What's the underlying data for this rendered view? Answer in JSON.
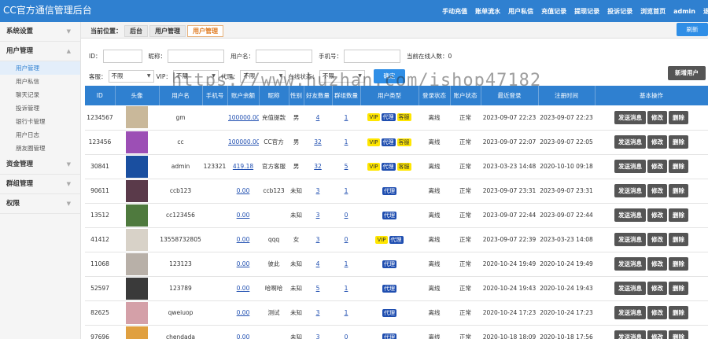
{
  "header": {
    "title": "CC官方通信管理后台",
    "nav": [
      "手动充值",
      "账单流水",
      "用户私信",
      "充值记录",
      "提现记录",
      "投诉记录",
      "浏览首页",
      "admin",
      "退出"
    ]
  },
  "sidebar": {
    "groups": [
      {
        "label": "系统设置"
      },
      {
        "label": "用户管理"
      },
      {
        "label": "资金管理"
      },
      {
        "label": "群组管理"
      },
      {
        "label": "权限"
      }
    ],
    "user_items": [
      "用户管理",
      "用户私信",
      "聊天记录",
      "投诉管理",
      "银行卡管理",
      "用户日志",
      "朋友圈管理"
    ]
  },
  "breadcrumb": {
    "label": "当前位置：",
    "segments": [
      "后台",
      "用户管理",
      "用户管理"
    ]
  },
  "refresh_label": "刷新",
  "filters": {
    "id_label": "ID：",
    "nick_label": "昵称：",
    "user_label": "用户名：",
    "phone_label": "手机号：",
    "online_text": "当前在线人数：0",
    "cs_label": "客服：",
    "vip_label": "VIP：",
    "agent_label": "代理：",
    "online_label": "在线状态：",
    "option": "不限",
    "submit": "确定",
    "add_user": "新增用户"
  },
  "watermark": "https://www.huzhan.com/ishop47182",
  "table": {
    "headers": [
      "ID",
      "头像",
      "用户名",
      "手机号",
      "账户余额",
      "昵称",
      "性别",
      "好友数量",
      "群组数量",
      "用户类型",
      "登录状态",
      "账户状态",
      "最近登录",
      "注册时间",
      "基本操作"
    ],
    "actions": [
      "发送消息",
      "修改",
      "删除"
    ],
    "rows": [
      {
        "id": "1234567",
        "user": "gm",
        "phone": "",
        "balance": "100000.00",
        "nick": "充值提款",
        "sex": "男",
        "friends": "4",
        "groups": "1",
        "tags": [
          "VIP",
          "代理",
          "客服"
        ],
        "login": "离线",
        "status": "正常",
        "last": "2023-09-07 22:23",
        "reg": "2023-09-07 22:23",
        "avatar": "#c9b89a"
      },
      {
        "id": "123456",
        "user": "cc",
        "phone": "",
        "balance": "100000.00",
        "nick": "CC官方",
        "sex": "男",
        "friends": "32",
        "groups": "1",
        "tags": [
          "VIP",
          "代理",
          "客服"
        ],
        "login": "离线",
        "status": "正常",
        "last": "2023-09-07 22:07",
        "reg": "2023-09-07 22:05",
        "avatar": "#9c4fb5"
      },
      {
        "id": "30841",
        "user": "admin",
        "phone": "123321",
        "balance": "419.18",
        "nick": "官方客服",
        "sex": "男",
        "friends": "32",
        "groups": "5",
        "tags": [
          "VIP",
          "代理",
          "客服"
        ],
        "login": "离线",
        "status": "正常",
        "last": "2023-03-23 14:48",
        "reg": "2020-10-10 09:18",
        "avatar": "#1a4fa0"
      },
      {
        "id": "90611",
        "user": "ccb123",
        "phone": "",
        "balance": "0.00",
        "nick": "ccb123",
        "sex": "未知",
        "friends": "3",
        "groups": "1",
        "tags": [
          "代理"
        ],
        "login": "离线",
        "status": "正常",
        "last": "2023-09-07 23:31",
        "reg": "2023-09-07 23:31",
        "avatar": "#5a3a4a"
      },
      {
        "id": "13512",
        "user": "cc123456",
        "phone": "",
        "balance": "0.00",
        "nick": "",
        "sex": "未知",
        "friends": "3",
        "groups": "0",
        "tags": [
          "代理"
        ],
        "login": "离线",
        "status": "正常",
        "last": "2023-09-07 22:44",
        "reg": "2023-09-07 22:44",
        "avatar": "#4f7a3e"
      },
      {
        "id": "41412",
        "user": "13558732805",
        "phone": "",
        "balance": "0.00",
        "nick": "qqq",
        "sex": "女",
        "friends": "3",
        "groups": "0",
        "tags": [
          "VIP",
          "代理"
        ],
        "login": "离线",
        "status": "正常",
        "last": "2023-09-07 22:39",
        "reg": "2023-03-23 14:08",
        "avatar": "#d8d2c8"
      },
      {
        "id": "11068",
        "user": "123123",
        "phone": "",
        "balance": "0.00",
        "nick": "彼此",
        "sex": "未知",
        "friends": "4",
        "groups": "1",
        "tags": [
          "代理"
        ],
        "login": "离线",
        "status": "正常",
        "last": "2020-10-24 19:49",
        "reg": "2020-10-24 19:49",
        "avatar": "#b8b0a8"
      },
      {
        "id": "52597",
        "user": "123789",
        "phone": "",
        "balance": "0.00",
        "nick": "哈啊哈",
        "sex": "未知",
        "friends": "5",
        "groups": "1",
        "tags": [
          "代理"
        ],
        "login": "离线",
        "status": "正常",
        "last": "2020-10-24 19:43",
        "reg": "2020-10-24 19:43",
        "avatar": "#3a3a3a"
      },
      {
        "id": "82625",
        "user": "qweiuop",
        "phone": "",
        "balance": "0.00",
        "nick": "测试",
        "sex": "未知",
        "friends": "3",
        "groups": "1",
        "tags": [
          "代理"
        ],
        "login": "离线",
        "status": "正常",
        "last": "2020-10-24 17:23",
        "reg": "2020-10-24 17:23",
        "avatar": "#d4a0a8"
      },
      {
        "id": "97696",
        "user": "chendada",
        "phone": "",
        "balance": "0.00",
        "nick": "",
        "sex": "未知",
        "friends": "3",
        "groups": "0",
        "tags": [
          "代理"
        ],
        "login": "离线",
        "status": "正常",
        "last": "2020-10-18 18:09",
        "reg": "2020-10-18 17:56",
        "avatar": "#e0a040"
      }
    ]
  }
}
